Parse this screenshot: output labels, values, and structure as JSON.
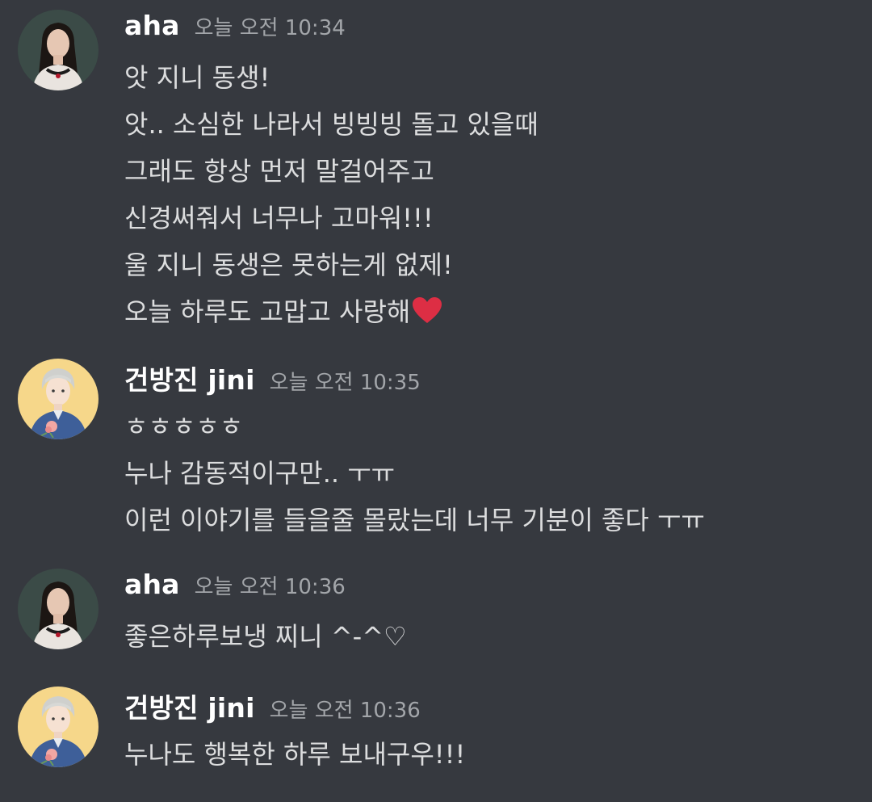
{
  "messages": [
    {
      "author": "aha",
      "avatar_icon": "aha-profile-photo-icon",
      "timestamp": "오늘 오전 10:34",
      "lines": [
        "앗 지니 동생!",
        "앗.. 소심한 나라서 빙빙빙 돌고 있을때",
        "그래도 항상 먼저 말걸어주고",
        "신경써줘서 너무나 고마워!!!",
        "울 지니 동생은 못하는게 없제!",
        "오늘 하루도 고맙고 사랑해"
      ],
      "emoji": "red-heart-icon"
    },
    {
      "author": "건방진 jini",
      "avatar_icon": "jini-illustrated-avatar-icon",
      "timestamp": "오늘 오전 10:35",
      "lines": [
        "ㅎㅎㅎㅎㅎ",
        "누나 감동적이구만.. ㅜㅠ",
        "이런 이야기를 들을줄 몰랐는데 너무 기분이 좋다 ㅜㅠ"
      ]
    },
    {
      "author": "aha",
      "avatar_icon": "aha-profile-photo-icon",
      "timestamp": "오늘 오전 10:36",
      "lines": [
        "좋은하루보냉 찌니 ^-^♡"
      ]
    },
    {
      "author": "건방진 jini",
      "avatar_icon": "jini-illustrated-avatar-icon",
      "timestamp": "오늘 오전 10:36",
      "lines": [
        "누나도 행복한 하루 보내구우!!!"
      ]
    }
  ],
  "colors": {
    "background": "#36393f",
    "username": "#ffffff",
    "timestamp": "#a3a6aa",
    "message_text": "#dcddde",
    "heart": "#dd2e44"
  }
}
